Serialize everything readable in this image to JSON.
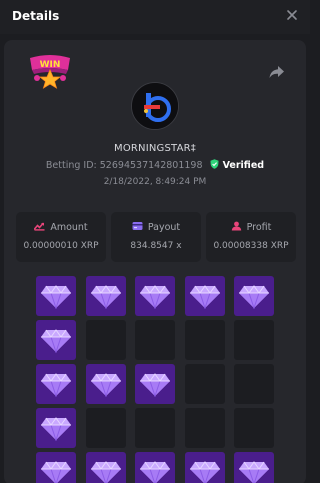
{
  "dialog": {
    "title": "Details"
  },
  "player": {
    "username": "MORNINGSTAR‡",
    "betting_id_label": "Betting ID:",
    "betting_id": "5269453714280119​8",
    "verified_label": "Verified",
    "date": "2/18/2022, 8:49:24 PM"
  },
  "stats": [
    {
      "label": "Amount",
      "value": "0.00000010 XRP",
      "icon": "amount-icon",
      "color": "#e8457a"
    },
    {
      "label": "Payout",
      "value": "834.8547 x",
      "icon": "payout-icon",
      "color": "#8a6cf0"
    },
    {
      "label": "Profit",
      "value": "0.00008338 XRP",
      "icon": "profit-icon",
      "color": "#e8457a"
    }
  ],
  "grid": {
    "rows": [
      [
        1,
        1,
        1,
        1,
        1
      ],
      [
        1,
        0,
        0,
        0,
        0
      ],
      [
        1,
        1,
        1,
        0,
        0
      ],
      [
        1,
        0,
        0,
        0,
        0
      ],
      [
        1,
        1,
        1,
        1,
        1
      ]
    ]
  },
  "colors": {
    "gem_tile": "#4a1e8c",
    "empty_tile": "#1c1d21",
    "verified_green": "#2fd37a",
    "win_badge": "#e0309a"
  },
  "icons": {
    "close": "close-icon",
    "share": "share-icon",
    "win": "win-badge-icon",
    "gem": "diamond-icon"
  },
  "badge": {
    "text": "WIN"
  }
}
